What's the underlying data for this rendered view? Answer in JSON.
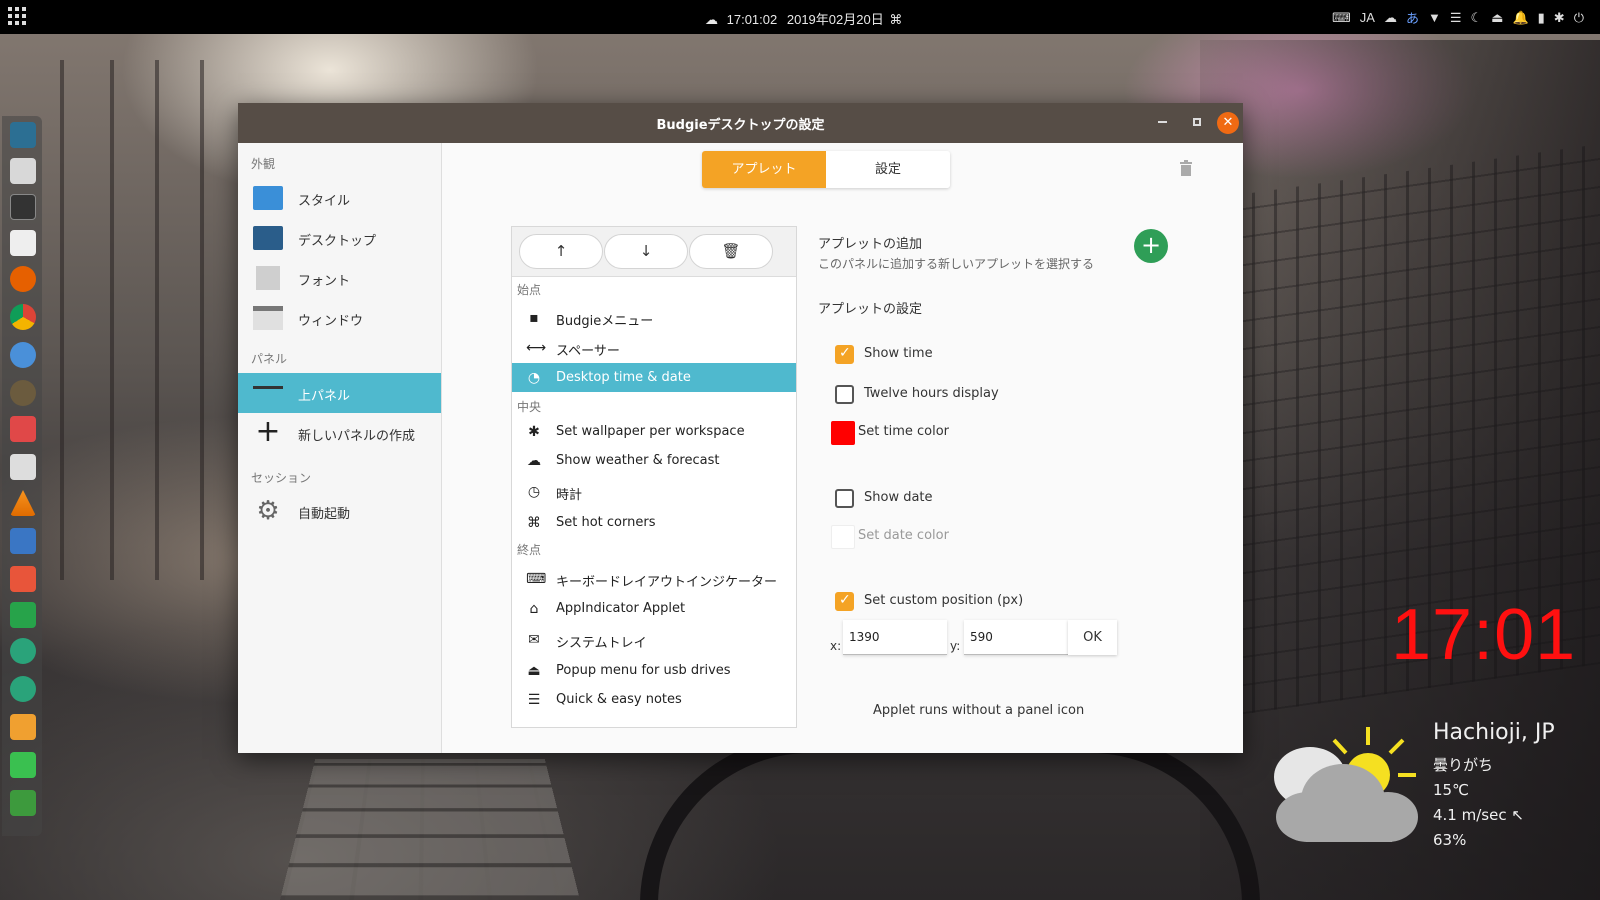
{
  "topbar": {
    "clock_text": "17:01:02",
    "date_text": "2019年02月20日",
    "tray": {
      "keyboard_layout": "JA",
      "ime": "あ"
    }
  },
  "window": {
    "title": "Budgieデスクトップの設定",
    "accent_color": "#f4a325",
    "selection_color": "#4fb9ce"
  },
  "sidebar": {
    "section_appearance": "外観",
    "section_panels": "パネル",
    "section_session": "セッション",
    "items": [
      {
        "label": "スタイル",
        "icon": "style-icon"
      },
      {
        "label": "デスクトップ",
        "icon": "desktop-icon"
      },
      {
        "label": "フォント",
        "icon": "font-icon"
      },
      {
        "label": "ウィンドウ",
        "icon": "window-icon"
      },
      {
        "label": "上パネル",
        "icon": "top-panel-icon",
        "active": true
      },
      {
        "label": "新しいパネルの作成",
        "icon": "plus-icon"
      },
      {
        "label": "自動起動",
        "icon": "gear-icon"
      }
    ]
  },
  "tabs": {
    "applets": "アプレット",
    "settings": "設定"
  },
  "applet_list": {
    "section_start": "始点",
    "section_center": "中央",
    "section_end": "終点",
    "start": [
      {
        "label": "Budgieメニュー",
        "icon": "grid-icon"
      },
      {
        "label": "スペーサー",
        "icon": "spacer-icon"
      },
      {
        "label": "Desktop time & date",
        "icon": "clock-pie-icon",
        "selected": true
      }
    ],
    "center": [
      {
        "label": "Set wallpaper per workspace",
        "icon": "asterisk-icon"
      },
      {
        "label": "Show weather & forecast",
        "icon": "cloud-icon"
      },
      {
        "label": "時計",
        "icon": "clock-icon"
      },
      {
        "label": "Set hot corners",
        "icon": "hot-corners-icon"
      }
    ],
    "end": [
      {
        "label": "キーボードレイアウトインジケーター",
        "icon": "keyboard-icon"
      },
      {
        "label": "AppIndicator Applet",
        "icon": "home-icon"
      },
      {
        "label": "システムトレイ",
        "icon": "envelope-icon"
      },
      {
        "label": "Popup menu for usb drives",
        "icon": "usb-icon"
      },
      {
        "label": "Quick & easy notes",
        "icon": "list-icon"
      }
    ]
  },
  "settings_pane": {
    "add_title": "アプレットの追加",
    "add_subtitle": "このパネルに追加する新しいアプレットを選択する",
    "applet_settings_title": "アプレットの設定",
    "show_time": {
      "label": "Show time",
      "checked": true
    },
    "twelve_hours": {
      "label": "Twelve hours display",
      "checked": false
    },
    "time_color": {
      "label": "Set time color",
      "color": "#ff0000"
    },
    "show_date": {
      "label": "Show date",
      "checked": false
    },
    "date_color": {
      "label": "Set date color",
      "color": "#ffffff",
      "disabled": true
    },
    "custom_position": {
      "label": "Set custom position (px)",
      "checked": true
    },
    "x_label": "x:",
    "x_value": "1390",
    "y_label": "y:",
    "y_value": "590",
    "ok_label": "OK",
    "note": "Applet runs without a panel icon"
  },
  "desktop": {
    "big_clock": "17:01",
    "big_clock_color": "#ff1010",
    "weather": {
      "city": "Hachioji, JP",
      "condition": "曇りがち",
      "temperature": "15℃",
      "wind": "4.1 m/sec ↖",
      "humidity": "63%"
    }
  }
}
